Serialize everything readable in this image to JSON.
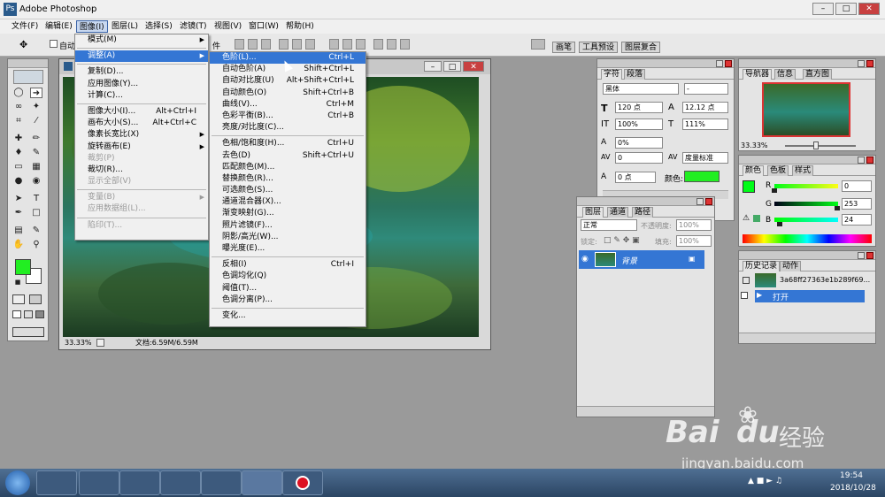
{
  "app": {
    "title": "Adobe Photoshop",
    "icon": "photoshop-icon"
  },
  "menubar": [
    "文件(F)",
    "编辑(E)",
    "图像(I)",
    "图层(L)",
    "选择(S)",
    "滤镜(T)",
    "视图(V)",
    "窗口(W)",
    "帮助(H)"
  ],
  "options_fragments": {
    "auto": "自动",
    "file": "件"
  },
  "palette_well_tabs": [
    "画笔",
    "工具预设",
    "图层复合"
  ],
  "image_menu": [
    {
      "label": "模式(M)",
      "arrow": true
    },
    {
      "sep": true
    },
    {
      "label": "调整(A)",
      "arrow": true,
      "highlight": true
    },
    {
      "sep": true
    },
    {
      "label": "复制(D)..."
    },
    {
      "label": "应用图像(Y)..."
    },
    {
      "label": "计算(C)..."
    },
    {
      "sep": true
    },
    {
      "label": "图像大小(I)...",
      "shortcut": "Alt+Ctrl+I"
    },
    {
      "label": "画布大小(S)...",
      "shortcut": "Alt+Ctrl+C"
    },
    {
      "label": "像素长宽比(X)",
      "arrow": true
    },
    {
      "label": "旋转画布(E)",
      "arrow": true
    },
    {
      "label": "裁剪(P)",
      "disabled": true
    },
    {
      "label": "裁切(R)..."
    },
    {
      "label": "显示全部(V)",
      "disabled": true
    },
    {
      "sep": true
    },
    {
      "label": "变量(B)",
      "arrow": true,
      "disabled": true
    },
    {
      "label": "应用数据组(L)...",
      "disabled": true
    },
    {
      "sep": true
    },
    {
      "label": "陷印(T)...",
      "disabled": true
    }
  ],
  "adjust_menu": [
    {
      "label": "色阶(L)...",
      "shortcut": "Ctrl+L",
      "highlight": true
    },
    {
      "label": "自动色阶(A)",
      "shortcut": "Shift+Ctrl+L"
    },
    {
      "label": "自动对比度(U)",
      "shortcut": "Alt+Shift+Ctrl+L"
    },
    {
      "label": "自动颜色(O)",
      "shortcut": "Shift+Ctrl+B"
    },
    {
      "label": "曲线(V)...",
      "shortcut": "Ctrl+M"
    },
    {
      "label": "色彩平衡(B)...",
      "shortcut": "Ctrl+B"
    },
    {
      "label": "亮度/对比度(C)..."
    },
    {
      "sep": true
    },
    {
      "label": "色相/饱和度(H)...",
      "shortcut": "Ctrl+U"
    },
    {
      "label": "去色(D)",
      "shortcut": "Shift+Ctrl+U"
    },
    {
      "label": "匹配颜色(M)..."
    },
    {
      "label": "替换颜色(R)..."
    },
    {
      "label": "可选颜色(S)..."
    },
    {
      "label": "通道混合器(X)..."
    },
    {
      "label": "渐变映射(G)..."
    },
    {
      "label": "照片滤镜(F)..."
    },
    {
      "label": "阴影/高光(W)..."
    },
    {
      "label": "曝光度(E)..."
    },
    {
      "sep": true
    },
    {
      "label": "反相(I)",
      "shortcut": "Ctrl+I"
    },
    {
      "label": "色调均化(Q)"
    },
    {
      "label": "阈值(T)..."
    },
    {
      "label": "色调分离(P)..."
    },
    {
      "sep": true
    },
    {
      "label": "变化..."
    }
  ],
  "document": {
    "zoom": "33.33%",
    "status": "文档:6.59M/6.59M"
  },
  "character": {
    "tabs": [
      "字符",
      "段落"
    ],
    "font": "黑体",
    "style": "-",
    "size": "120 点",
    "leading": "12.12 点",
    "vscale": "100%",
    "hscale": "111%",
    "baseline": "0%",
    "tracking": "0",
    "kerning": "度量标准",
    "shift": "0 点",
    "color_label": "颜色:",
    "color": "#22ee22"
  },
  "navigator": {
    "tabs": [
      "导航器",
      "信息",
      "直方图"
    ],
    "zoom": "33.33%"
  },
  "color_panel": {
    "tabs": [
      "颜色",
      "色板",
      "样式"
    ],
    "r_label": "R",
    "g_label": "G",
    "b_label": "B",
    "r": "0",
    "g": "253",
    "b": "24",
    "r_frac": 0,
    "g_frac": 0.99,
    "b_frac": 0.09,
    "fg": "#00fd18"
  },
  "history": {
    "tabs": [
      "历史记录",
      "动作"
    ],
    "snapshot": "3a68ff27363e1b289f69...",
    "step": "打开"
  },
  "layers": {
    "tabs": [
      "图层",
      "通道",
      "路径"
    ],
    "blend": "正常",
    "opacity_label": "不透明度:",
    "opacity": "100%",
    "lock_label": "锁定:",
    "fill_label": "填充:",
    "fill": "100%",
    "layer_name": "背景"
  },
  "tools": {
    "fg_color": "#22ee22",
    "bg_color": "#ffffff"
  },
  "taskbar": {
    "time": "19:54",
    "date": "2018/10/28",
    "apps": [
      "ie-icon",
      "explorer-icon",
      "qq-icon",
      "firefox-icon",
      "media-icon",
      "photoshop-icon",
      "record-icon"
    ]
  },
  "watermark": {
    "brand": "Bai",
    "brand2": "du",
    "cn": "经验",
    "url": "jingyan.baidu.com"
  }
}
